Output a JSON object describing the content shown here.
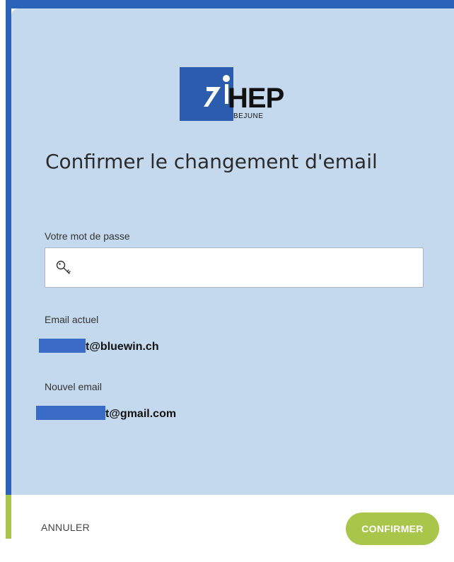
{
  "logo": {
    "text": "HEP",
    "subtext": "BEJUNE",
    "color": "#2b5cad"
  },
  "dialog": {
    "title": "Confirmer le changement d'email",
    "password_label": "Votre mot de passe",
    "password_value": "",
    "password_icon": "key-icon",
    "current_email_label": "Email actuel",
    "current_email_visible": "t@bluewin.ch",
    "new_email_label": "Nouvel email",
    "new_email_visible": "t@gmail.com"
  },
  "footer": {
    "cancel_label": "ANNULER",
    "confirm_label": "CONFIRMER"
  },
  "colors": {
    "card_bg": "#c5d9ee",
    "accent_blue": "#2b63b8",
    "accent_green": "#a7c64a",
    "redaction": "#3a6bc6"
  }
}
